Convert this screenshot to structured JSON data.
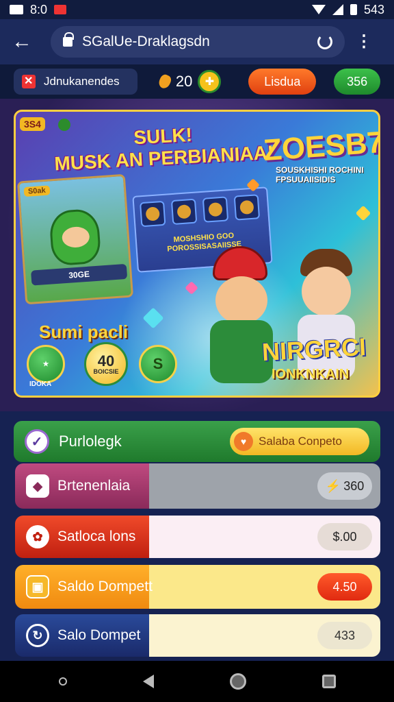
{
  "status_bar": {
    "time": "8:0",
    "right_text": "543"
  },
  "browser": {
    "url": "SGalUe-Draklagsdn"
  },
  "game_bar": {
    "player_name": "Jdnukanendes",
    "coins": "20",
    "red_pill": "Lisdua",
    "green_pill": "356"
  },
  "banner": {
    "tag": "3S4",
    "title_line1": "SULK!",
    "title_line2": "MUSK AN PERBIANIAA!",
    "big_number": "ZOESB7",
    "big_sub": "SOUSKHISHI ROCHINI FPSUUAIISIDIS",
    "mini_label": "S0ak",
    "mini_bar": "30GE",
    "items_text": "MOSHSHIO GOO POROSSISASAIISSE",
    "logo": "NIRGRCI",
    "logo_sub": "IONKNKAIN",
    "sumi": "Sumi pacli",
    "btn1_label": "IDOKA",
    "btn2_number": "40",
    "btn2_sub": "BOICSIE",
    "btn3_label": "S"
  },
  "list_header": {
    "title": "Purlolegk",
    "button_label": "Salaba Conpeto"
  },
  "rows": [
    {
      "label": "Brtenenlaia",
      "value": "360",
      "icon": "diamond-icon"
    },
    {
      "label": "Satloca lons",
      "value": "$.00",
      "icon": "gear-icon"
    },
    {
      "label": "Saldo Dompett",
      "value": "4.50",
      "icon": "box-icon"
    },
    {
      "label": "Salo Dompet",
      "value": "433",
      "icon": "refresh-icon"
    }
  ]
}
